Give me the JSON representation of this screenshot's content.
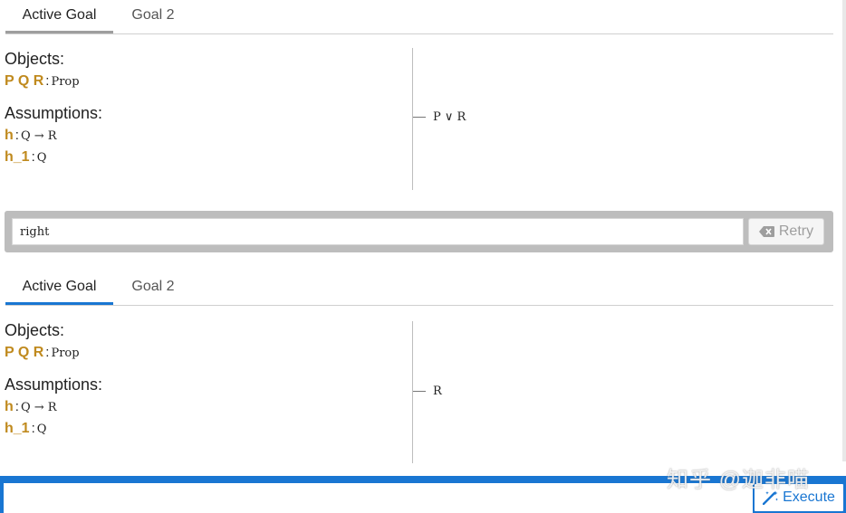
{
  "panels": [
    {
      "tabs": {
        "active": "Active Goal",
        "other": "Goal 2"
      },
      "objects_heading": "Objects:",
      "objects": {
        "names": "P Q R",
        "colon": ":",
        "type": "Prop"
      },
      "assumptions_heading": "Assumptions:",
      "assumptions": [
        {
          "name": "h",
          "colon": ":",
          "type": "Q → R"
        },
        {
          "name": "h_1",
          "colon": ":",
          "type": "Q"
        }
      ],
      "target": "P ∨ R"
    },
    {
      "tabs": {
        "active": "Active Goal",
        "other": "Goal 2"
      },
      "objects_heading": "Objects:",
      "objects": {
        "names": "P Q R",
        "colon": ":",
        "type": "Prop"
      },
      "assumptions_heading": "Assumptions:",
      "assumptions": [
        {
          "name": "h",
          "colon": ":",
          "type": "Q → R"
        },
        {
          "name": "h_1",
          "colon": ":",
          "type": "Q"
        }
      ],
      "target": "R"
    }
  ],
  "command_bar": {
    "command_value": "right",
    "retry_label": "Retry"
  },
  "input_bar": {
    "tactic_value": "",
    "execute_label": "Execute"
  },
  "watermark": "知乎 @迦非喵",
  "colors": {
    "accent": "#1976d2",
    "hyp_name": "#c08a1e",
    "tab_underline_inactive": "#9e9e9e"
  },
  "icons": {
    "retry": "backspace-icon",
    "execute": "magic-wand-icon"
  }
}
